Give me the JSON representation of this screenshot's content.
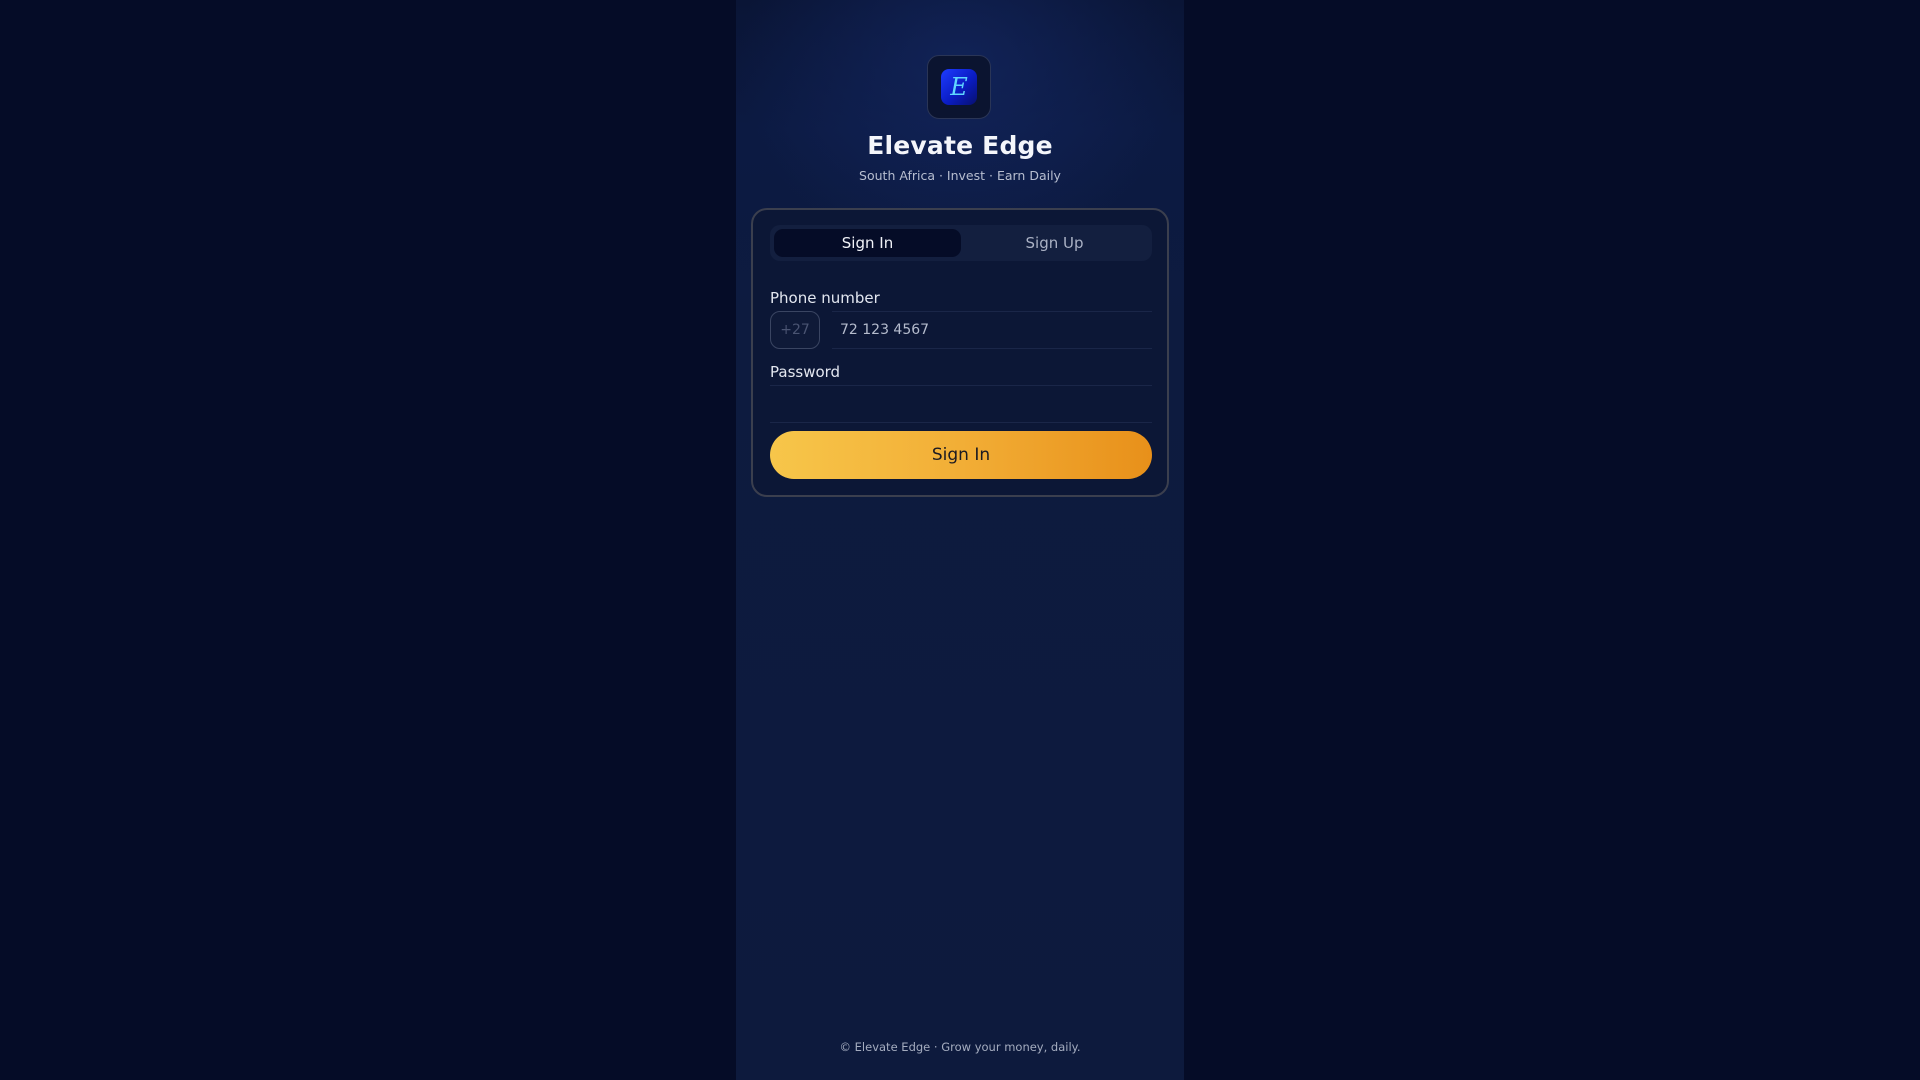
{
  "brand": {
    "logo_glyph": "E",
    "name": "Elevate Edge",
    "tagline": "South Africa · Invest · Earn Daily"
  },
  "auth": {
    "tabs": [
      {
        "label": "Sign In",
        "active": true
      },
      {
        "label": "Sign Up",
        "active": false
      }
    ],
    "phone": {
      "label": "Phone number",
      "country_code": "+27",
      "placeholder": "72 123 4567",
      "value": ""
    },
    "password": {
      "label": "Password",
      "placeholder": "",
      "value": ""
    },
    "submit_label": "Sign In"
  },
  "footer": {
    "text": "© Elevate Edge · Grow your money, daily."
  },
  "colors": {
    "background": "#050c27",
    "accent_start": "#f7c64a",
    "accent_end": "#e8901a"
  }
}
